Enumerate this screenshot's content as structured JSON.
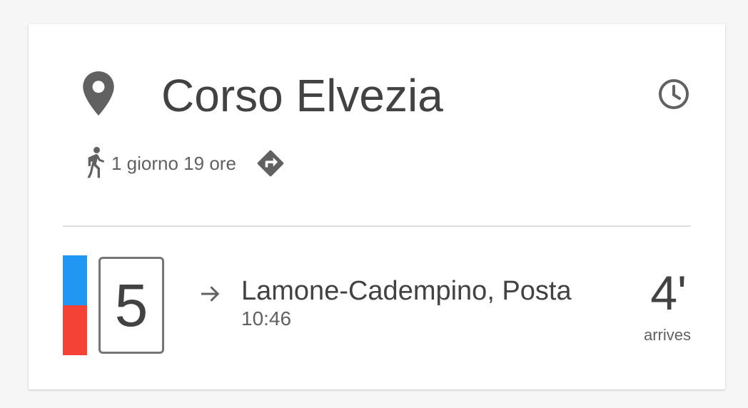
{
  "stop": {
    "icon": "location-pin-icon",
    "name": "Corso Elvezia",
    "schedule_icon": "clock-icon"
  },
  "walk": {
    "icon": "walking-person-icon",
    "duration": "1 giorno 19 ore",
    "directions_icon": "directions-icon"
  },
  "departure": {
    "line_colors": [
      "#2196f3",
      "#f44336"
    ],
    "line_number": "5",
    "direction_icon": "arrow-right-icon",
    "destination": "Lamone-Cadempino, Posta",
    "time": "10:46",
    "minutes": "4'",
    "status": "arrives"
  },
  "colors": {
    "text_primary": "#424242",
    "text_secondary": "#616161",
    "icon": "#616161",
    "divider": "#e0e0e0",
    "background": "#f6f6f6",
    "card": "#ffffff"
  }
}
